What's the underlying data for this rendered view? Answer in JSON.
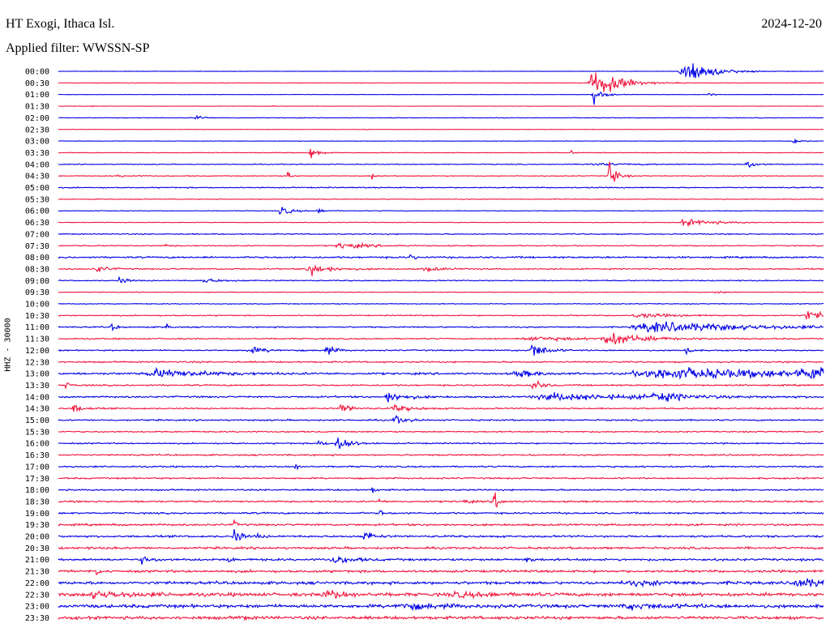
{
  "header": {
    "station": "HT Exogi, Ithaca Isl.",
    "filter": "Applied filter: WWSSN-SP",
    "date": "2024-12-20"
  },
  "colors": {
    "trace_a": "#0000e6",
    "trace_b": "#f0143c"
  },
  "chart_data": {
    "type": "line",
    "title": "HT Exogi, Ithaca Isl.",
    "subtitle": "Applied filter: WWSSN-SP",
    "date": "2024-12-20",
    "ylabel": "HHZ - 30000",
    "grid": false,
    "legend": "none",
    "trace_colors_alternate": [
      "#0000e6",
      "#f0143c"
    ],
    "rows": [
      {
        "label": "00:00",
        "noise": 0.15,
        "events": [
          [
            0.82,
            0.03,
            12
          ]
        ]
      },
      {
        "label": "00:30",
        "noise": 0.25,
        "events": [
          [
            0.7,
            0.025,
            16
          ],
          [
            0.725,
            0.015,
            6
          ]
        ]
      },
      {
        "label": "01:00",
        "noise": 0.15,
        "events": [
          [
            0.7,
            0.01,
            8
          ],
          [
            0.85,
            0.005,
            3
          ]
        ]
      },
      {
        "label": "01:30",
        "noise": 0.15,
        "events": [
          [
            0.04,
            0.003,
            2
          ],
          [
            0.28,
            0.003,
            2
          ]
        ]
      },
      {
        "label": "02:00",
        "noise": 0.3,
        "events": [
          [
            0.18,
            0.01,
            2.5
          ]
        ]
      },
      {
        "label": "02:30",
        "noise": 0.15,
        "events": [
          [
            0.4,
            0.003,
            2
          ]
        ]
      },
      {
        "label": "03:00",
        "noise": 0.2,
        "events": [
          [
            0.96,
            0.008,
            3
          ]
        ]
      },
      {
        "label": "03:30",
        "noise": 0.3,
        "events": [
          [
            0.33,
            0.007,
            8
          ],
          [
            0.67,
            0.003,
            2
          ]
        ]
      },
      {
        "label": "04:00",
        "noise": 0.4,
        "events": [
          [
            0.9,
            0.01,
            4
          ],
          [
            0.7,
            0.05,
            1
          ]
        ]
      },
      {
        "label": "04:30",
        "noise": 0.35,
        "events": [
          [
            0.72,
            0.008,
            16
          ],
          [
            0.3,
            0.004,
            5
          ],
          [
            0.41,
            0.003,
            8
          ],
          [
            0.08,
            0.02,
            1
          ]
        ]
      },
      {
        "label": "05:00",
        "noise": 0.5,
        "events": []
      },
      {
        "label": "05:30",
        "noise": 0.35,
        "events": []
      },
      {
        "label": "06:00",
        "noise": 0.3,
        "events": [
          [
            0.29,
            0.012,
            5
          ],
          [
            0.34,
            0.01,
            2
          ]
        ]
      },
      {
        "label": "06:30",
        "noise": 0.3,
        "events": [
          [
            0.82,
            0.04,
            3
          ]
        ]
      },
      {
        "label": "07:00",
        "noise": 0.5,
        "events": []
      },
      {
        "label": "07:30",
        "noise": 0.5,
        "events": [
          [
            0.37,
            0.03,
            3
          ],
          [
            0.14,
            0.005,
            2
          ]
        ]
      },
      {
        "label": "08:00",
        "noise": 0.8,
        "events": [
          [
            0.46,
            0.004,
            4
          ]
        ]
      },
      {
        "label": "08:30",
        "noise": 0.6,
        "events": [
          [
            0.33,
            0.02,
            6
          ],
          [
            0.05,
            0.012,
            4
          ],
          [
            0.48,
            0.02,
            2
          ]
        ]
      },
      {
        "label": "09:00",
        "noise": 0.5,
        "events": [
          [
            0.08,
            0.008,
            4
          ],
          [
            0.19,
            0.02,
            2
          ]
        ]
      },
      {
        "label": "09:30",
        "noise": 0.3,
        "events": [
          [
            0.86,
            0.01,
            2
          ]
        ]
      },
      {
        "label": "10:00",
        "noise": 0.4,
        "events": []
      },
      {
        "label": "10:30",
        "noise": 0.5,
        "events": [
          [
            0.98,
            0.02,
            5
          ],
          [
            0.76,
            0.04,
            2
          ]
        ]
      },
      {
        "label": "11:00",
        "noise": 0.6,
        "events": [
          [
            0.78,
            0.12,
            5
          ],
          [
            0.07,
            0.005,
            4
          ],
          [
            0.14,
            0.003,
            6
          ]
        ]
      },
      {
        "label": "11:30",
        "noise": 0.6,
        "events": [
          [
            0.72,
            0.04,
            6
          ],
          [
            0.62,
            0.05,
            2
          ]
        ]
      },
      {
        "label": "12:00",
        "noise": 0.6,
        "events": [
          [
            0.62,
            0.015,
            8
          ],
          [
            0.35,
            0.01,
            5
          ],
          [
            0.25,
            0.02,
            3
          ],
          [
            0.82,
            0.005,
            6
          ]
        ]
      },
      {
        "label": "12:30",
        "noise": 0.7,
        "events": []
      },
      {
        "label": "13:00",
        "noise": 0.9,
        "events": [
          [
            0.13,
            0.06,
            4
          ],
          [
            0.8,
            0.2,
            5
          ],
          [
            0.6,
            0.02,
            4
          ],
          [
            0.98,
            0.06,
            5
          ]
        ]
      },
      {
        "label": "13:30",
        "noise": 0.7,
        "events": [
          [
            0.62,
            0.01,
            6
          ],
          [
            0.01,
            0.004,
            4
          ]
        ]
      },
      {
        "label": "14:00",
        "noise": 0.8,
        "events": [
          [
            0.43,
            0.02,
            5
          ],
          [
            0.65,
            0.12,
            3
          ],
          [
            0.78,
            0.03,
            4
          ]
        ]
      },
      {
        "label": "14:30",
        "noise": 0.7,
        "events": [
          [
            0.37,
            0.01,
            6
          ],
          [
            0.02,
            0.01,
            4
          ],
          [
            0.44,
            0.02,
            3
          ]
        ]
      },
      {
        "label": "15:00",
        "noise": 0.7,
        "events": [
          [
            0.44,
            0.01,
            5
          ]
        ]
      },
      {
        "label": "15:30",
        "noise": 0.6,
        "events": []
      },
      {
        "label": "16:00",
        "noise": 0.6,
        "events": [
          [
            0.365,
            0.012,
            10
          ],
          [
            0.34,
            0.01,
            2
          ]
        ]
      },
      {
        "label": "16:30",
        "noise": 0.7,
        "events": []
      },
      {
        "label": "17:00",
        "noise": 0.7,
        "events": [
          [
            0.31,
            0.004,
            3
          ]
        ]
      },
      {
        "label": "17:30",
        "noise": 0.7,
        "events": []
      },
      {
        "label": "18:00",
        "noise": 0.7,
        "events": [
          [
            0.41,
            0.004,
            3
          ]
        ]
      },
      {
        "label": "18:30",
        "noise": 0.8,
        "events": [
          [
            0.57,
            0.006,
            9
          ],
          [
            0.53,
            0.005,
            3
          ],
          [
            0.42,
            0.004,
            3
          ]
        ]
      },
      {
        "label": "19:00",
        "noise": 0.8,
        "events": [
          [
            0.42,
            0.004,
            4
          ]
        ]
      },
      {
        "label": "19:30",
        "noise": 0.9,
        "events": [
          [
            0.23,
            0.004,
            4
          ]
        ]
      },
      {
        "label": "20:00",
        "noise": 0.9,
        "events": [
          [
            0.23,
            0.008,
            8
          ],
          [
            0.4,
            0.008,
            8
          ],
          [
            0.26,
            0.004,
            3
          ]
        ]
      },
      {
        "label": "20:30",
        "noise": 1.0,
        "events": []
      },
      {
        "label": "21:00",
        "noise": 1.0,
        "events": [
          [
            0.11,
            0.01,
            4
          ],
          [
            0.22,
            0.004,
            5
          ],
          [
            0.36,
            0.02,
            4
          ],
          [
            0.61,
            0.006,
            4
          ]
        ]
      },
      {
        "label": "21:30",
        "noise": 1.1,
        "events": [
          [
            0.05,
            0.004,
            4
          ]
        ]
      },
      {
        "label": "22:00",
        "noise": 1.3,
        "events": [
          [
            0.97,
            0.04,
            4
          ],
          [
            0.75,
            0.05,
            2
          ]
        ]
      },
      {
        "label": "22:30",
        "noise": 1.5,
        "events": [
          [
            0.35,
            0.02,
            5
          ],
          [
            0.05,
            0.05,
            3
          ],
          [
            0.52,
            0.05,
            2
          ]
        ]
      },
      {
        "label": "23:00",
        "noise": 1.5,
        "events": [
          [
            0.45,
            0.04,
            3
          ],
          [
            0.75,
            0.06,
            2
          ]
        ]
      },
      {
        "label": "23:30",
        "noise": 1.4,
        "events": [
          [
            0.24,
            0.005,
            3
          ]
        ]
      }
    ]
  }
}
